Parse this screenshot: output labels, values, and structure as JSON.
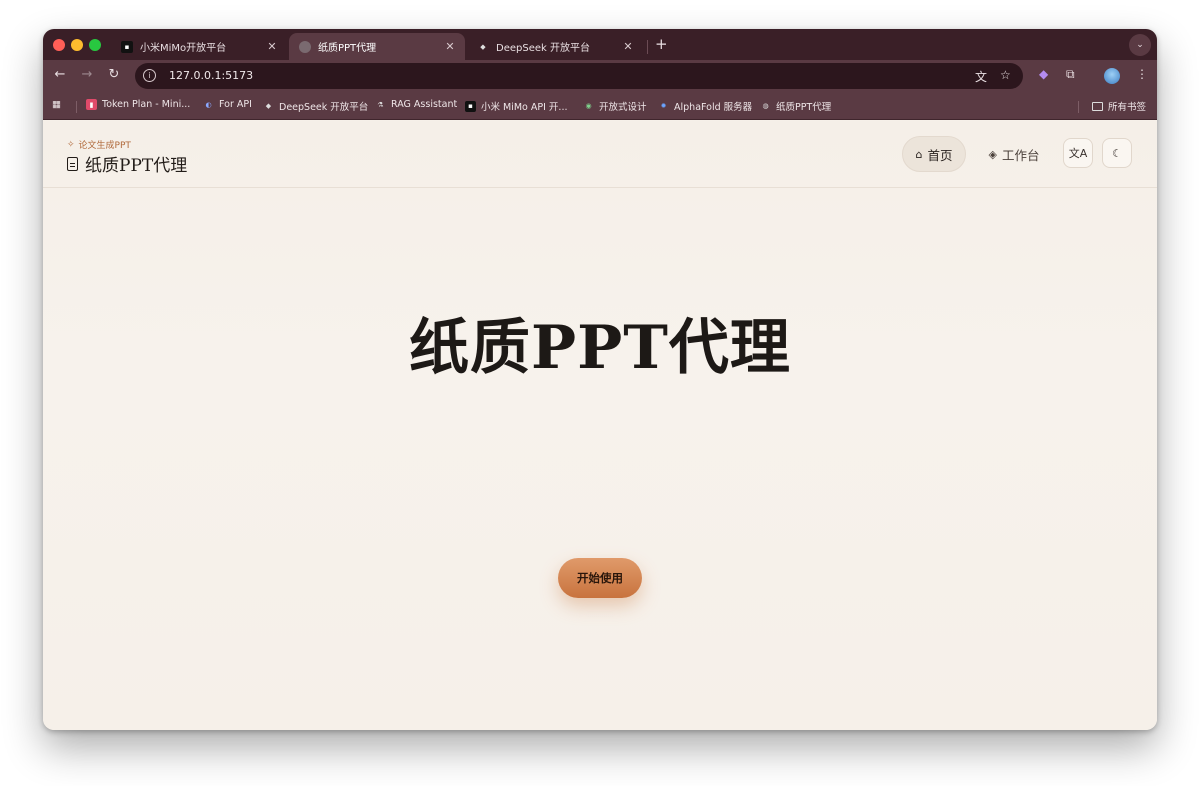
{
  "browser": {
    "tabs": [
      {
        "title": "小米MiMo开放平台",
        "active": false
      },
      {
        "title": "纸质PPT代理",
        "active": true
      },
      {
        "title": "DeepSeek 开放平台",
        "active": false
      }
    ],
    "url": "127.0.0.1:5173",
    "bookmarks": [
      {
        "label": "Token Plan - Mini..."
      },
      {
        "label": "For API"
      },
      {
        "label": "DeepSeek 开放平台"
      },
      {
        "label": "RAG Assistant"
      },
      {
        "label": "小米 MiMo API 开..."
      },
      {
        "label": "开放式设计"
      },
      {
        "label": "AlphaFold 服务器"
      },
      {
        "label": "纸质PPT代理"
      }
    ],
    "all_bookmarks_label": "所有书签"
  },
  "header": {
    "eyebrow": "论文生成PPT",
    "brand": "纸质PPT代理",
    "nav": {
      "home": "首页",
      "workspace": "工作台"
    }
  },
  "hero": {
    "title": "纸质PPT代理",
    "cta": "开始使用"
  },
  "colors": {
    "accent": "#c8733e",
    "page_background": "#f6f0e9",
    "browser_chrome": "#5a3a43"
  }
}
